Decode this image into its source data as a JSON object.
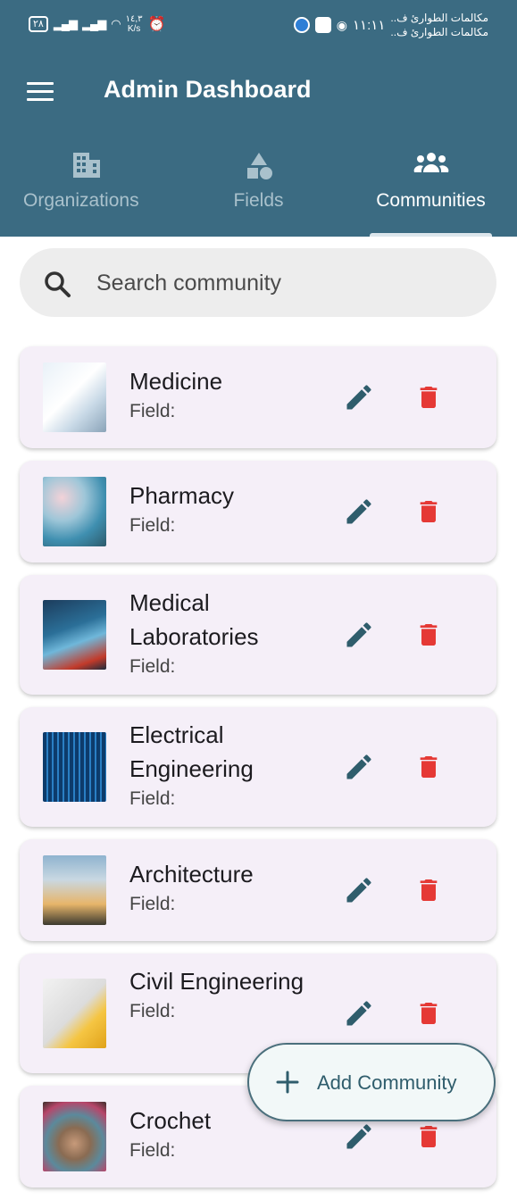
{
  "status_bar": {
    "battery": "٢٨",
    "net_speed_top": "١٤,٣",
    "net_speed_unit": "K/s",
    "time": "١١:١١",
    "notification_1": "مكالمات الطوارئ ف..",
    "notification_2": "مكالمات الطوارئ ف.."
  },
  "appbar": {
    "title": "Admin Dashboard"
  },
  "tabs": [
    {
      "label": "Organizations",
      "icon": "building-icon",
      "active": false
    },
    {
      "label": "Fields",
      "icon": "shapes-icon",
      "active": false
    },
    {
      "label": "Communities",
      "icon": "groups-icon",
      "active": true
    }
  ],
  "search": {
    "placeholder": "Search community"
  },
  "communities": [
    {
      "name": "Medicine",
      "field": "Field:"
    },
    {
      "name": "Pharmacy",
      "field": "Field:"
    },
    {
      "name": "Medical Laboratories",
      "field": "Field:"
    },
    {
      "name": "Electrical Engineering",
      "field": "Field:"
    },
    {
      "name": "Architecture",
      "field": "Field:"
    },
    {
      "name": "Civil Engineering",
      "field": "Field:"
    },
    {
      "name": "Crochet",
      "field": "Field:"
    }
  ],
  "fab": {
    "label": "Add Community"
  },
  "colors": {
    "primary": "#3b6b82",
    "edit": "#2f5d6c",
    "delete": "#e53935",
    "card": "#f5eff8"
  }
}
